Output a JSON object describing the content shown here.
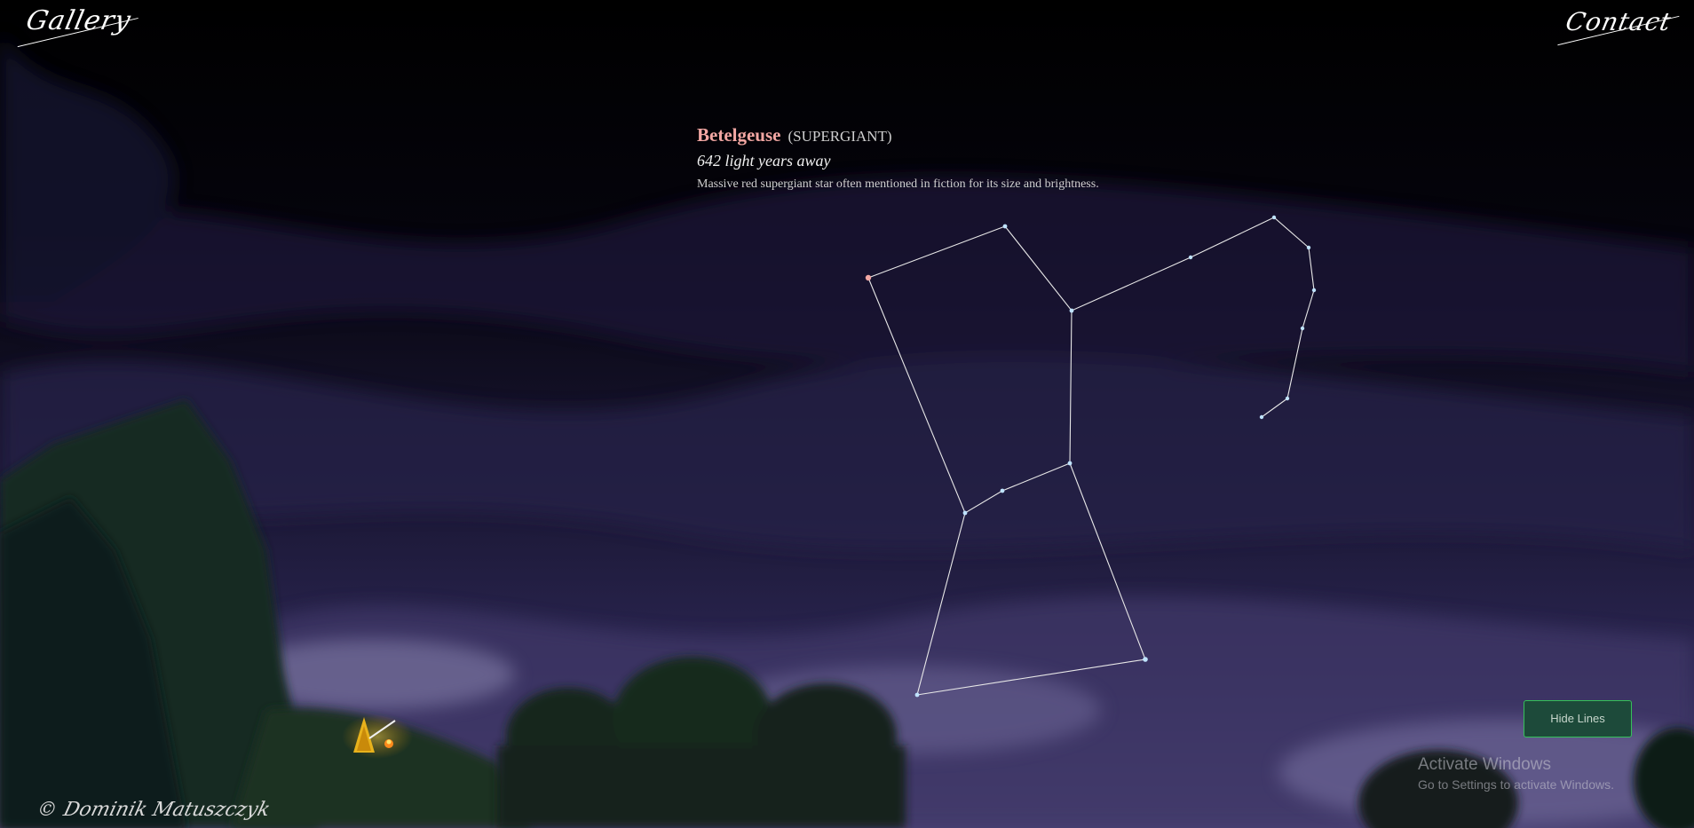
{
  "nav": {
    "gallery_label": "Gallery",
    "contact_label": "Contact"
  },
  "star_info": {
    "name": "Betelgeuse",
    "classification": "(SUPERGIANT)",
    "distance": "642 light years away",
    "description": "Massive red supergiant star often mentioned in fiction for its size and brightness."
  },
  "controls": {
    "hide_lines_label": "Hide Lines"
  },
  "watermark": {
    "title": "Activate Windows",
    "subtitle": "Go to Settings to activate Windows."
  },
  "footer": {
    "copyright_symbol": "©",
    "signature": "Dominik Matuszczyk"
  },
  "colors": {
    "star_highlight": "#f3a7a3",
    "line_color": "#e8e8e8",
    "button_border": "#35c05a",
    "sky_dark": "#000000",
    "sky_purple": "#2c2752"
  },
  "constellation": {
    "highlighted_star": "Betelgeuse"
  }
}
